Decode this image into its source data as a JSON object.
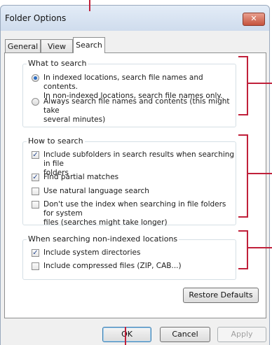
{
  "window": {
    "title": "Folder Options",
    "close_glyph": "✕"
  },
  "tabs": [
    {
      "label": "General"
    },
    {
      "label": "View"
    },
    {
      "label": "Search",
      "active": true
    }
  ],
  "what_to_search": {
    "legend": "What to search",
    "options": [
      {
        "label": "In indexed locations, search file names and contents.",
        "label2": "In non-indexed locations, search file names only.",
        "selected": true
      },
      {
        "label": "Always search file names and contents (this might take",
        "label2": "several minutes)",
        "selected": false
      }
    ]
  },
  "how_to_search": {
    "legend": "How to search",
    "options": [
      {
        "label": "Include subfolders in search results when searching in file",
        "label2": "folders",
        "checked": true
      },
      {
        "label": "Find partial matches",
        "checked": true
      },
      {
        "label": "Use natural language search",
        "checked": false
      },
      {
        "label": "Don't use the index when searching in file folders for system",
        "label2": "files (searches might take longer)",
        "checked": false
      }
    ]
  },
  "non_indexed": {
    "legend": "When searching non-indexed locations",
    "options": [
      {
        "label": "Include system directories",
        "checked": true
      },
      {
        "label": "Include compressed files (ZIP, CAB...)",
        "checked": false
      }
    ]
  },
  "buttons": {
    "restore": "Restore Defaults",
    "ok": "OK",
    "cancel": "Cancel",
    "apply": "Apply"
  },
  "check_glyph": "✓",
  "accent_color": "#c0203a"
}
